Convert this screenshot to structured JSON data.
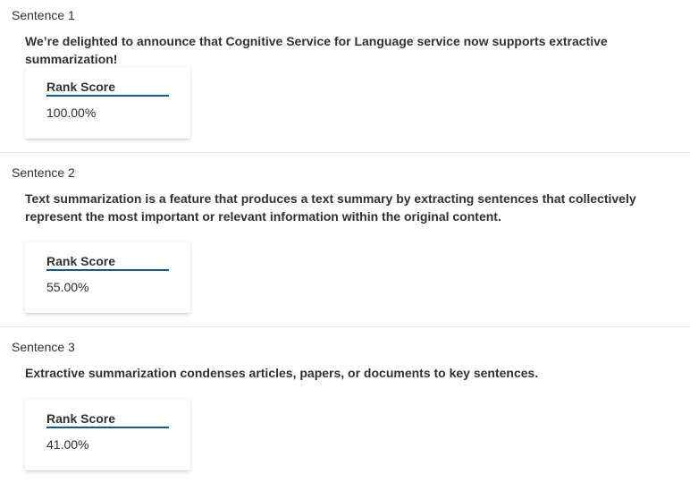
{
  "sentences": [
    {
      "label": "Sentence 1",
      "text": "We’re delighted to announce that Cognitive Service for Language service now supports extractive summarization!",
      "score_title": "Rank Score",
      "score_value": "100.00%"
    },
    {
      "label": "Sentence 2",
      "text": "Text summarization is a feature that produces a text summary by extracting sentences that collectively represent the most important or relevant information within the original content.",
      "score_title": "Rank Score",
      "score_value": "55.00%"
    },
    {
      "label": "Sentence 3",
      "text": "Extractive summarization condenses articles, papers, or documents to key sentences.",
      "score_title": "Rank Score",
      "score_value": "41.00%"
    }
  ],
  "colors": {
    "accent": "#0f5a93",
    "text": "#323130",
    "divider": "#e6e6e6"
  }
}
